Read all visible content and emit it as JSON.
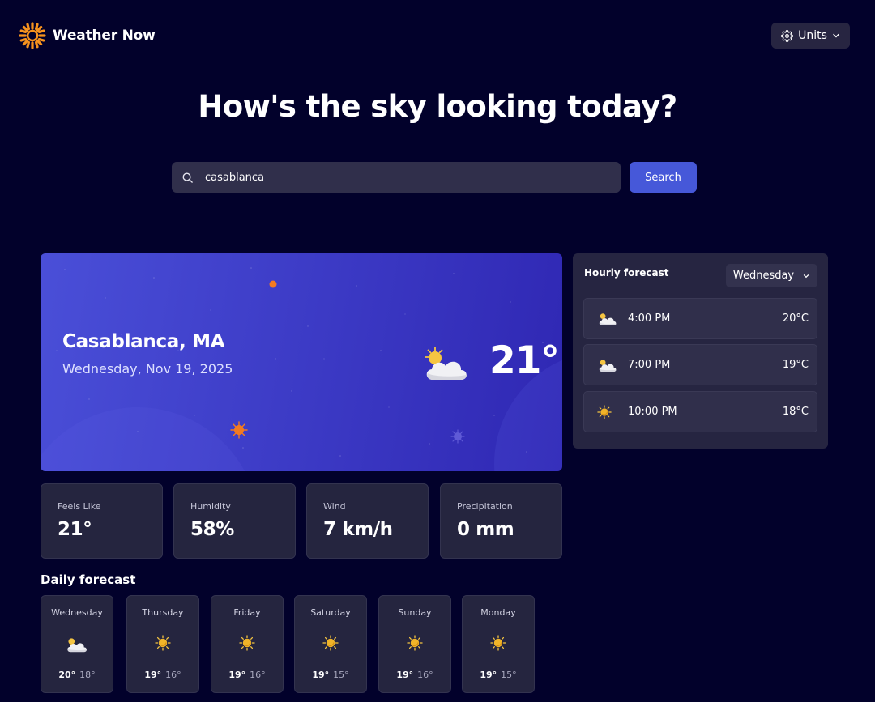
{
  "app": {
    "title": "Weather Now"
  },
  "header": {
    "units_label": "Units"
  },
  "hero": {
    "title": "How's the sky looking today?"
  },
  "search": {
    "value": "casablanca",
    "button_label": "Search"
  },
  "current": {
    "city": "Casablanca, MA",
    "date": "Wednesday, Nov 19, 2025",
    "temperature": "21°",
    "icon": "partly-cloudy-icon"
  },
  "stats": [
    {
      "label": "Feels Like",
      "value": "21°"
    },
    {
      "label": "Humidity",
      "value": "58%"
    },
    {
      "label": "Wind",
      "value": "7 km/h"
    },
    {
      "label": "Precipitation",
      "value": "0 mm"
    }
  ],
  "daily": {
    "title": "Daily forecast",
    "days": [
      {
        "name": "Wednesday",
        "high": "20°",
        "low": "18°",
        "icon": "partly-cloudy-icon"
      },
      {
        "name": "Thursday",
        "high": "19°",
        "low": "16°",
        "icon": "sun-icon"
      },
      {
        "name": "Friday",
        "high": "19°",
        "low": "16°",
        "icon": "sun-icon"
      },
      {
        "name": "Saturday",
        "high": "19°",
        "low": "15°",
        "icon": "sun-icon"
      },
      {
        "name": "Sunday",
        "high": "19°",
        "low": "16°",
        "icon": "sun-icon"
      },
      {
        "name": "Monday",
        "high": "19°",
        "low": "15°",
        "icon": "sun-icon"
      }
    ]
  },
  "hourly": {
    "title": "Hourly forecast",
    "selected_day": "Wednesday",
    "hours": [
      {
        "time": "4:00 PM",
        "temp": "20°C",
        "icon": "partly-cloudy-icon"
      },
      {
        "time": "7:00 PM",
        "temp": "19°C",
        "icon": "partly-cloudy-icon"
      },
      {
        "time": "10:00 PM",
        "temp": "18°C",
        "icon": "sun-icon"
      }
    ]
  },
  "colors": {
    "background": "#02012b",
    "accent": "#4658d9",
    "card": "#25253f",
    "sun": "#f5a623"
  }
}
